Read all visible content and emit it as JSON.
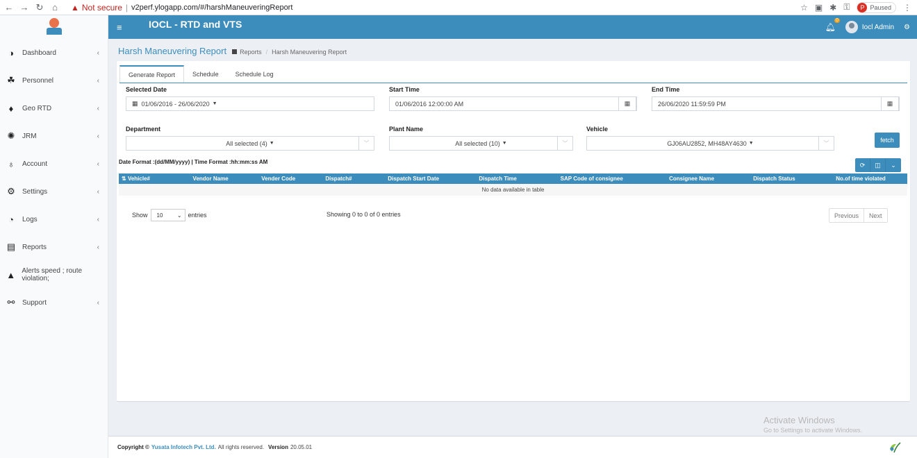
{
  "browser": {
    "security": "Not secure",
    "url": "v2perf.ylogapp.com/#/harshManeuveringReport",
    "profile_initial": "P",
    "profile_status": "Paused"
  },
  "header": {
    "app_title": "IOCL - RTD and VTS",
    "notification_count": "0",
    "user_name": "Iocl Admin"
  },
  "sidebar": {
    "items": [
      {
        "label": "Dashboard",
        "icon": "dashboard-icon",
        "chevron": "‹"
      },
      {
        "label": "Personnel",
        "icon": "personnel-icon",
        "chevron": "‹"
      },
      {
        "label": "Geo RTD",
        "icon": "map-pin-icon",
        "chevron": "‹"
      },
      {
        "label": "JRM",
        "icon": "gear-icon",
        "chevron": "‹"
      },
      {
        "label": "Account",
        "icon": "account-icon",
        "chevron": "‹"
      },
      {
        "label": "Settings",
        "icon": "cog-icon",
        "chevron": "‹"
      },
      {
        "label": "Logs",
        "icon": "clock-icon",
        "chevron": "‹"
      },
      {
        "label": "Reports",
        "icon": "reports-icon",
        "chevron": "‹"
      },
      {
        "label": "Alerts speed ; route violation;",
        "icon": "bell-icon",
        "chevron": ""
      },
      {
        "label": "Support",
        "icon": "support-icon",
        "chevron": "‹"
      }
    ]
  },
  "page": {
    "title": "Harsh Maneuvering Report",
    "breadcrumb_1": "Reports",
    "breadcrumb_2": "Harsh Maneuvering Report"
  },
  "tabs": [
    "Generate Report",
    "Schedule",
    "Schedule Log"
  ],
  "form": {
    "selected_date_label": "Selected Date",
    "selected_date_value": "01/06/2016 - 26/06/2020",
    "start_time_label": "Start Time",
    "start_time_value": "01/06/2016 12:00:00 AM",
    "end_time_label": "End Time",
    "end_time_value": "26/06/2020 11:59:59 PM",
    "department_label": "Department",
    "department_value": "All selected (4)",
    "plant_label": "Plant Name",
    "plant_value": "All selected (10)",
    "vehicle_label": "Vehicle",
    "vehicle_value": "GJ06AU2852, MH48AY4630",
    "fetch_label": "fetch"
  },
  "format_note": "Date Format :(dd/MM/yyyy) | Time Format :hh:mm:ss AM",
  "table": {
    "columns": [
      "Vehicle#",
      "Vendor Name",
      "Vender Code",
      "Dispatch#",
      "Dispatch Start Date",
      "Dispatch Time",
      "SAP Code of consignee",
      "Consignee Name",
      "Dispatch Status",
      "No.of time violated"
    ],
    "empty_text": "No data available in table"
  },
  "pagination": {
    "show_label": "Show",
    "page_size": "10",
    "entries_label": "entries",
    "info": "Showing 0 to 0 of 0 entries",
    "previous": "Previous",
    "next": "Next"
  },
  "watermark": {
    "line1": "Activate Windows",
    "line2": "Go to Settings to activate Windows."
  },
  "footer": {
    "copyright": "Copyright ©",
    "company": "Yusata Infotech Pvt. Ltd.",
    "rights": "All rights reserved.",
    "version_label": "Version",
    "version": "20.05.01"
  },
  "colors": {
    "primary": "#3c8dbc",
    "background": "#ecf0f5"
  }
}
